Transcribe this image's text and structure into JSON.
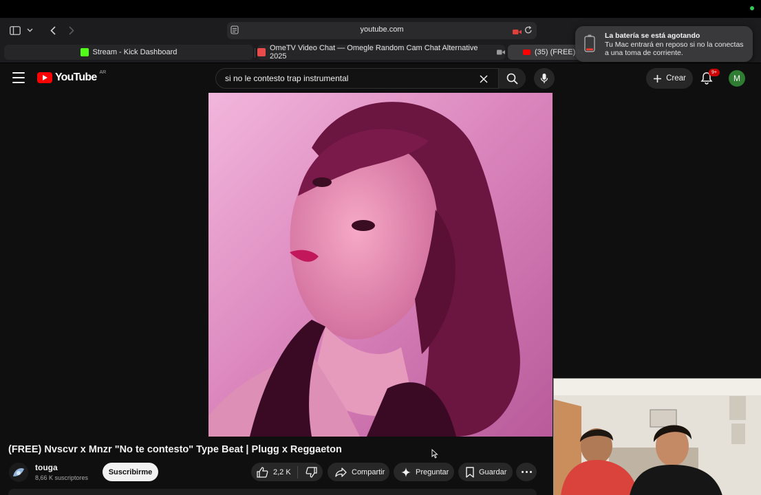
{
  "browser": {
    "url": "youtube.com",
    "tabs": [
      {
        "label": "Stream - Kick Dashboard",
        "favicon_color": "#53fc18"
      },
      {
        "label": "OmeTV Video Chat — Omegle Random Cam Chat Alternative 2025",
        "favicon_color": "#e94b4b"
      },
      {
        "label": "(35) (FREE) N",
        "favicon_color": "#ff0000"
      }
    ]
  },
  "notification": {
    "title": "La batería se está agotando",
    "message": "Tu Mac entrará en reposo si no la conectas a una toma de corriente."
  },
  "youtube": {
    "logo_text": "YouTube",
    "country_code": "AR",
    "search_query": "si no le contesto trap instrumental",
    "create_label": "Crear",
    "notification_count": "9+",
    "avatar_letter": "M",
    "video_title": "(FREE) Nvscvr x Mnzr \"No te contesto\" Type Beat | Plugg x Reggaeton",
    "channel_name": "touga",
    "subscribers": "8,66 K suscriptores",
    "subscribe_label": "Suscribirme",
    "like_count": "2,2 K",
    "share_label": "Compartir",
    "ask_label": "Preguntar",
    "save_label": "Guardar"
  },
  "colors": {
    "youtube_red": "#ff0000",
    "background": "#0f0f0f",
    "chip": "#272727",
    "avatar_green": "#2e7d32"
  }
}
